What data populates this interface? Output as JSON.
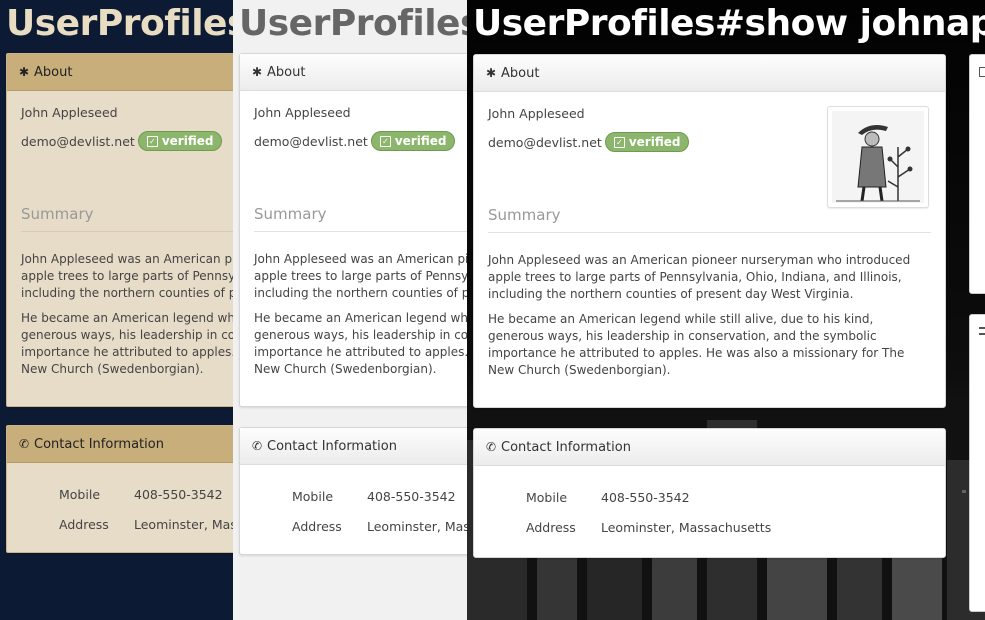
{
  "page": {
    "heading": "UserProfiles#show johnappleseed"
  },
  "about": {
    "title": "About",
    "icon": "asterisk-icon",
    "name": "John Appleseed",
    "email": "demo@devlist.net",
    "verified_label": "verified",
    "summary_title": "Summary",
    "paragraphs": [
      "John Appleseed was an American pioneer nurseryman who introduced apple trees to large parts of Pennsylvania, Ohio, Indiana, and Illinois, including the northern counties of present day West Virginia.",
      "He became an American legend while still alive, due to his kind, generous ways, his leadership in conservation, and the symbolic importance he attributed to apples. He was also a missionary for The New Church (Swedenborgian)."
    ]
  },
  "contact": {
    "title": "Contact Information",
    "icon": "phone-icon",
    "rows": [
      {
        "label": "Mobile",
        "value": "408-550-3542"
      },
      {
        "label": "Address",
        "value": "Leominster, Massachusetts"
      }
    ]
  },
  "themes": {
    "theme_1": {
      "background": "#0c1a33",
      "panel_header": "#c8ae7b",
      "panel_body": "#e7dcc8",
      "heading_color": "#e8dcc2"
    },
    "theme_2": {
      "background": "#f1f1f1",
      "panel_header": "#f2f2f2",
      "panel_body": "#ffffff",
      "heading_color": "#666666"
    },
    "theme_3": {
      "background": "#050505",
      "panel_header": "#f2f2f2",
      "panel_body": "#ffffff",
      "heading_color": "#ffffff"
    }
  },
  "colors": {
    "verified_badge": "#8bb66b"
  }
}
